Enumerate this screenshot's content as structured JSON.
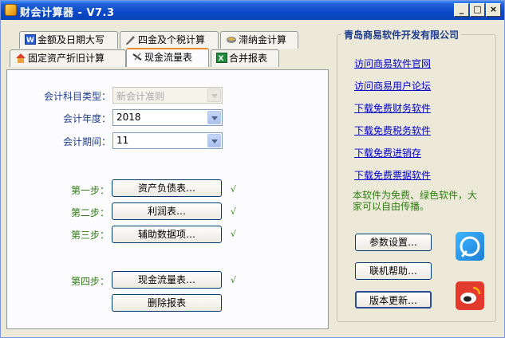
{
  "window": {
    "title": "财会计算器 - V7.3",
    "controls": {
      "minimize": "_",
      "maximize": "□",
      "close": "×"
    }
  },
  "tabs": {
    "row1": [
      {
        "label": "金额及日期大写",
        "icon": "document-w-icon"
      },
      {
        "label": "四金及个税计算",
        "icon": "pen-icon"
      },
      {
        "label": "滞纳金计算",
        "icon": "gear-tool-icon"
      }
    ],
    "row2": [
      {
        "label": "固定资产折旧计算",
        "icon": "house-icon"
      },
      {
        "label": "现金流量表",
        "icon": "cash-flow-icon",
        "active": true
      },
      {
        "label": "合并报表",
        "icon": "excel-icon"
      }
    ]
  },
  "form": {
    "subject_type_label": "会计科目类型：",
    "subject_type_value": "新会计准则",
    "year_label": "会计年度：",
    "year_value": "2018",
    "period_label": "会计期间：",
    "period_value": "11"
  },
  "steps": [
    {
      "label": "第一步：",
      "button": "资产负债表…",
      "check": "√"
    },
    {
      "label": "第二步：",
      "button": "利润表…",
      "check": "√"
    },
    {
      "label": "第三步：",
      "button": "辅助数据项…",
      "check": "√"
    },
    {
      "label": "第四步：",
      "button": "现金流量表…",
      "check": "√"
    }
  ],
  "delete_button": "删除报表",
  "sidebar": {
    "title": "青岛商易软件开发有限公司",
    "links": [
      "访问商易软件官网",
      "访问商易用户论坛",
      "下载免费财务软件",
      "下载免费税务软件",
      "下载免费进销存",
      "下载免费票据软件"
    ],
    "note": "本软件为免费、绿色软件，大家可以自由传播。",
    "buttons": {
      "settings": "参数设置…",
      "help": "联机帮助…",
      "update": "版本更新…"
    }
  },
  "colors": {
    "title_bar": "#0b48c7",
    "link": "#0000cc",
    "green_text": "#2e7d12",
    "blue_label": "#1f3d8c",
    "active_tab_accent": "#e68b2c"
  }
}
